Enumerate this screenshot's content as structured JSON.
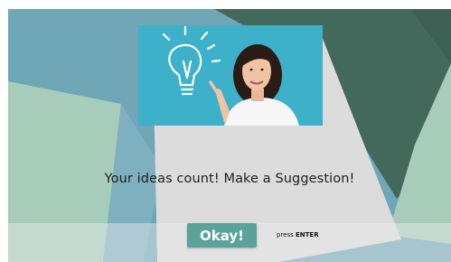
{
  "form": {
    "hero_image": "lightbulb-idea-woman",
    "question": "Your ideas count! Make a Suggestion!",
    "okay_label": "Okay!",
    "hint_prefix": "press",
    "hint_key": "ENTER"
  },
  "colors": {
    "accent": "#5aa39b",
    "background_base": "#6fa7b6",
    "card": "#d9d9d9"
  }
}
